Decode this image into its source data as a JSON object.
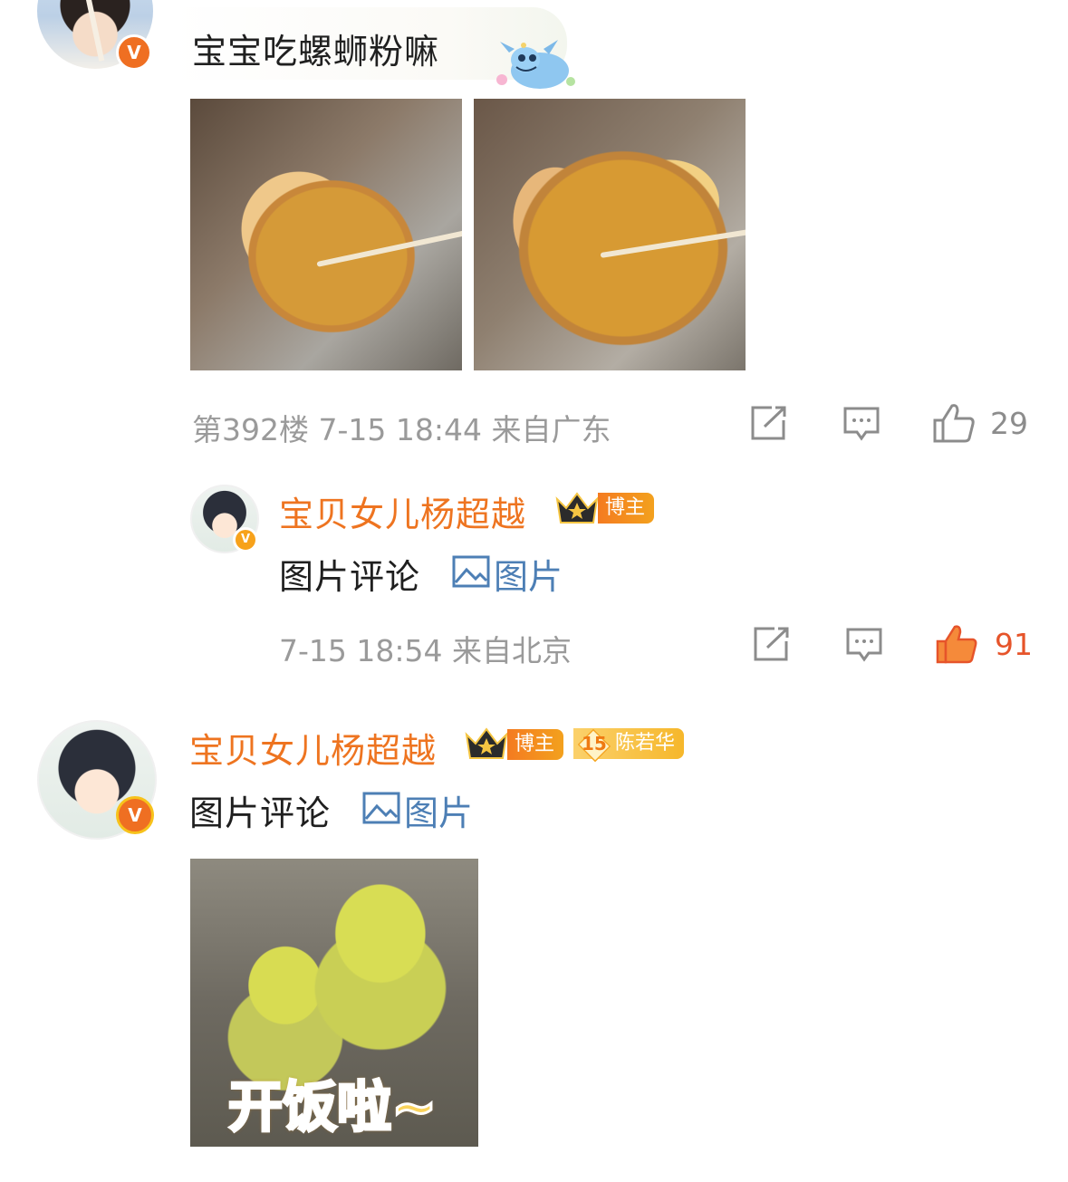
{
  "comment1": {
    "text": "宝宝吃螺蛳粉嘛",
    "meta": "第392楼 7-15 18:44 来自广东",
    "likes": "29"
  },
  "reply1": {
    "username": "宝贝女儿杨超越",
    "badge": "博主",
    "text": "图片评论",
    "image_link": "图片",
    "meta": "7-15 18:54 来自北京",
    "likes": "91"
  },
  "comment2": {
    "username": "宝贝女儿杨超越",
    "badge": "博主",
    "fan_level": "15",
    "fan_label": "陈若华",
    "text": "图片评论",
    "image_link": "图片",
    "gif_caption": "开饭啦~"
  },
  "colors": {
    "accent_orange": "#ee7420",
    "link_blue": "#4d7fb5",
    "like_active": "#e6542a",
    "meta_gray": "#9a9a9a"
  },
  "icons": [
    "verified-badge-icon",
    "repost-icon",
    "comment-icon",
    "like-icon",
    "like-filled-icon",
    "crown-icon",
    "image-icon"
  ]
}
